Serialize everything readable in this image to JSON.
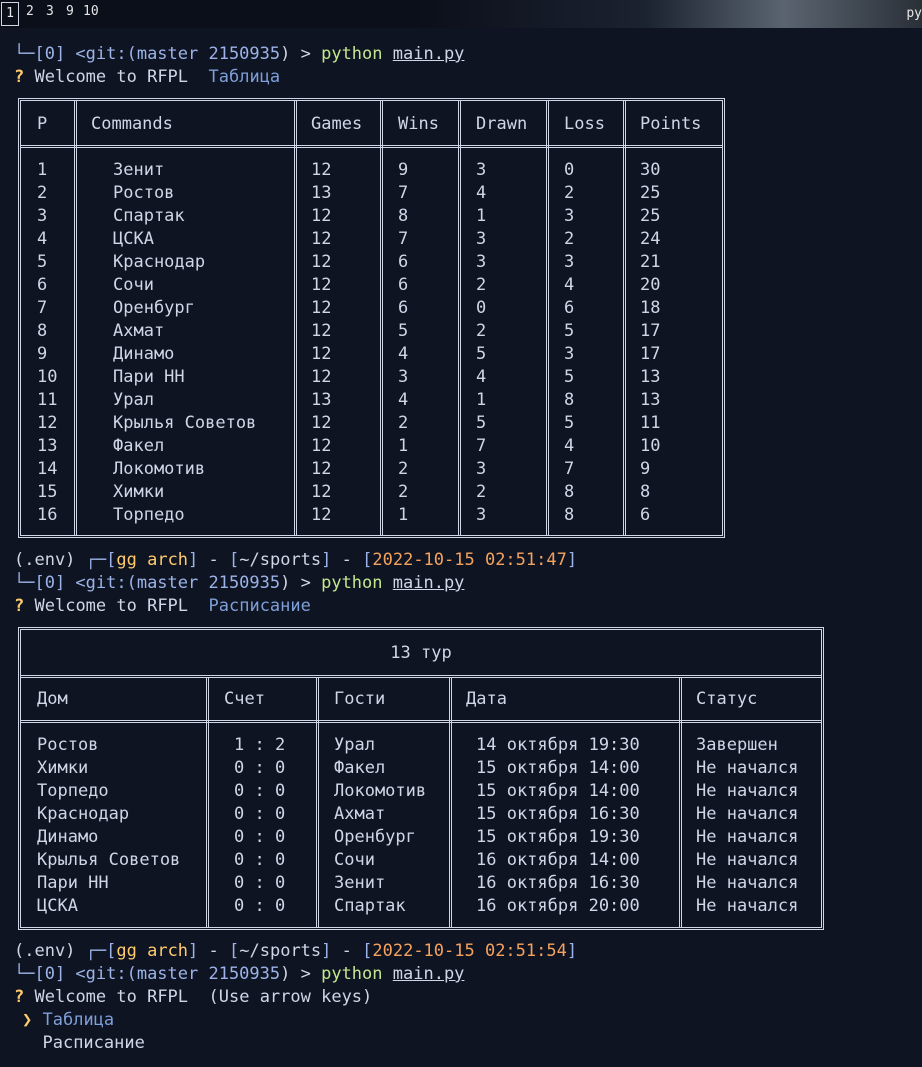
{
  "topbar": {
    "workspaces": [
      "1",
      "2",
      "3",
      "9",
      "10"
    ],
    "right_text": "py"
  },
  "prompt": {
    "env": "(.env)",
    "user": "gg arch",
    "dir": "~/sports",
    "ts1": "2022-10-15 02:51:47",
    "ts2": "2022-10-15 02:51:54",
    "git_line_prefix": "└─[0] <git:(",
    "git_branch": "master 2150935",
    "git_line_suffix": ") >",
    "cmd": "python",
    "arg": "main.py"
  },
  "welcome": "Welcome to RFPL",
  "choice1": "Таблица",
  "choice2": "Расписание",
  "hint": "(Use arrow keys)",
  "standings": {
    "headers": [
      "P",
      "Commands",
      "Games",
      "Wins",
      "Drawn",
      "Loss",
      "Points"
    ],
    "rows": [
      [
        "1",
        "Зенит",
        "12",
        "9",
        "3",
        "0",
        "30"
      ],
      [
        "2",
        "Ростов",
        "13",
        "7",
        "4",
        "2",
        "25"
      ],
      [
        "3",
        "Спартак",
        "12",
        "8",
        "1",
        "3",
        "25"
      ],
      [
        "4",
        "ЦСКА",
        "12",
        "7",
        "3",
        "2",
        "24"
      ],
      [
        "5",
        "Краснодар",
        "12",
        "6",
        "3",
        "3",
        "21"
      ],
      [
        "6",
        "Сочи",
        "12",
        "6",
        "2",
        "4",
        "20"
      ],
      [
        "7",
        "Оренбург",
        "12",
        "6",
        "0",
        "6",
        "18"
      ],
      [
        "8",
        "Ахмат",
        "12",
        "5",
        "2",
        "5",
        "17"
      ],
      [
        "9",
        "Динамо",
        "12",
        "4",
        "5",
        "3",
        "17"
      ],
      [
        "10",
        "Пари НН",
        "12",
        "3",
        "4",
        "5",
        "13"
      ],
      [
        "11",
        "Урал",
        "13",
        "4",
        "1",
        "8",
        "13"
      ],
      [
        "12",
        "Крылья Советов",
        "12",
        "2",
        "5",
        "5",
        "11"
      ],
      [
        "13",
        "Факел",
        "12",
        "1",
        "7",
        "4",
        "10"
      ],
      [
        "14",
        "Локомотив",
        "12",
        "2",
        "3",
        "7",
        "9"
      ],
      [
        "15",
        "Химки",
        "12",
        "2",
        "2",
        "8",
        "8"
      ],
      [
        "16",
        "Торпедо",
        "12",
        "1",
        "3",
        "8",
        "6"
      ]
    ]
  },
  "schedule": {
    "title": "13 тур",
    "headers": [
      "Дом",
      "Счет",
      "Гости",
      "Дата",
      "Статус"
    ],
    "rows": [
      [
        "Ростов",
        "1 : 2",
        "Урал",
        "14 октября 19:30",
        "Завершен"
      ],
      [
        "Химки",
        "0 : 0",
        "Факел",
        "15 октября 14:00",
        "Не начался"
      ],
      [
        "Торпедо",
        "0 : 0",
        "Локомотив",
        "15 октября 14:00",
        "Не начался"
      ],
      [
        "Краснодар",
        "0 : 0",
        "Ахмат",
        "15 октября 16:30",
        "Не начался"
      ],
      [
        "Динамо",
        "0 : 0",
        "Оренбург",
        "15 октября 19:30",
        "Не начался"
      ],
      [
        "Крылья Советов",
        "0 : 0",
        "Сочи",
        "16 октября 14:00",
        "Не начался"
      ],
      [
        "Пари НН",
        "0 : 0",
        "Зенит",
        "16 октября 16:30",
        "Не начался"
      ],
      [
        "ЦСКА",
        "0 : 0",
        "Спартак",
        "16 октября 20:00",
        "Не начался"
      ]
    ]
  }
}
